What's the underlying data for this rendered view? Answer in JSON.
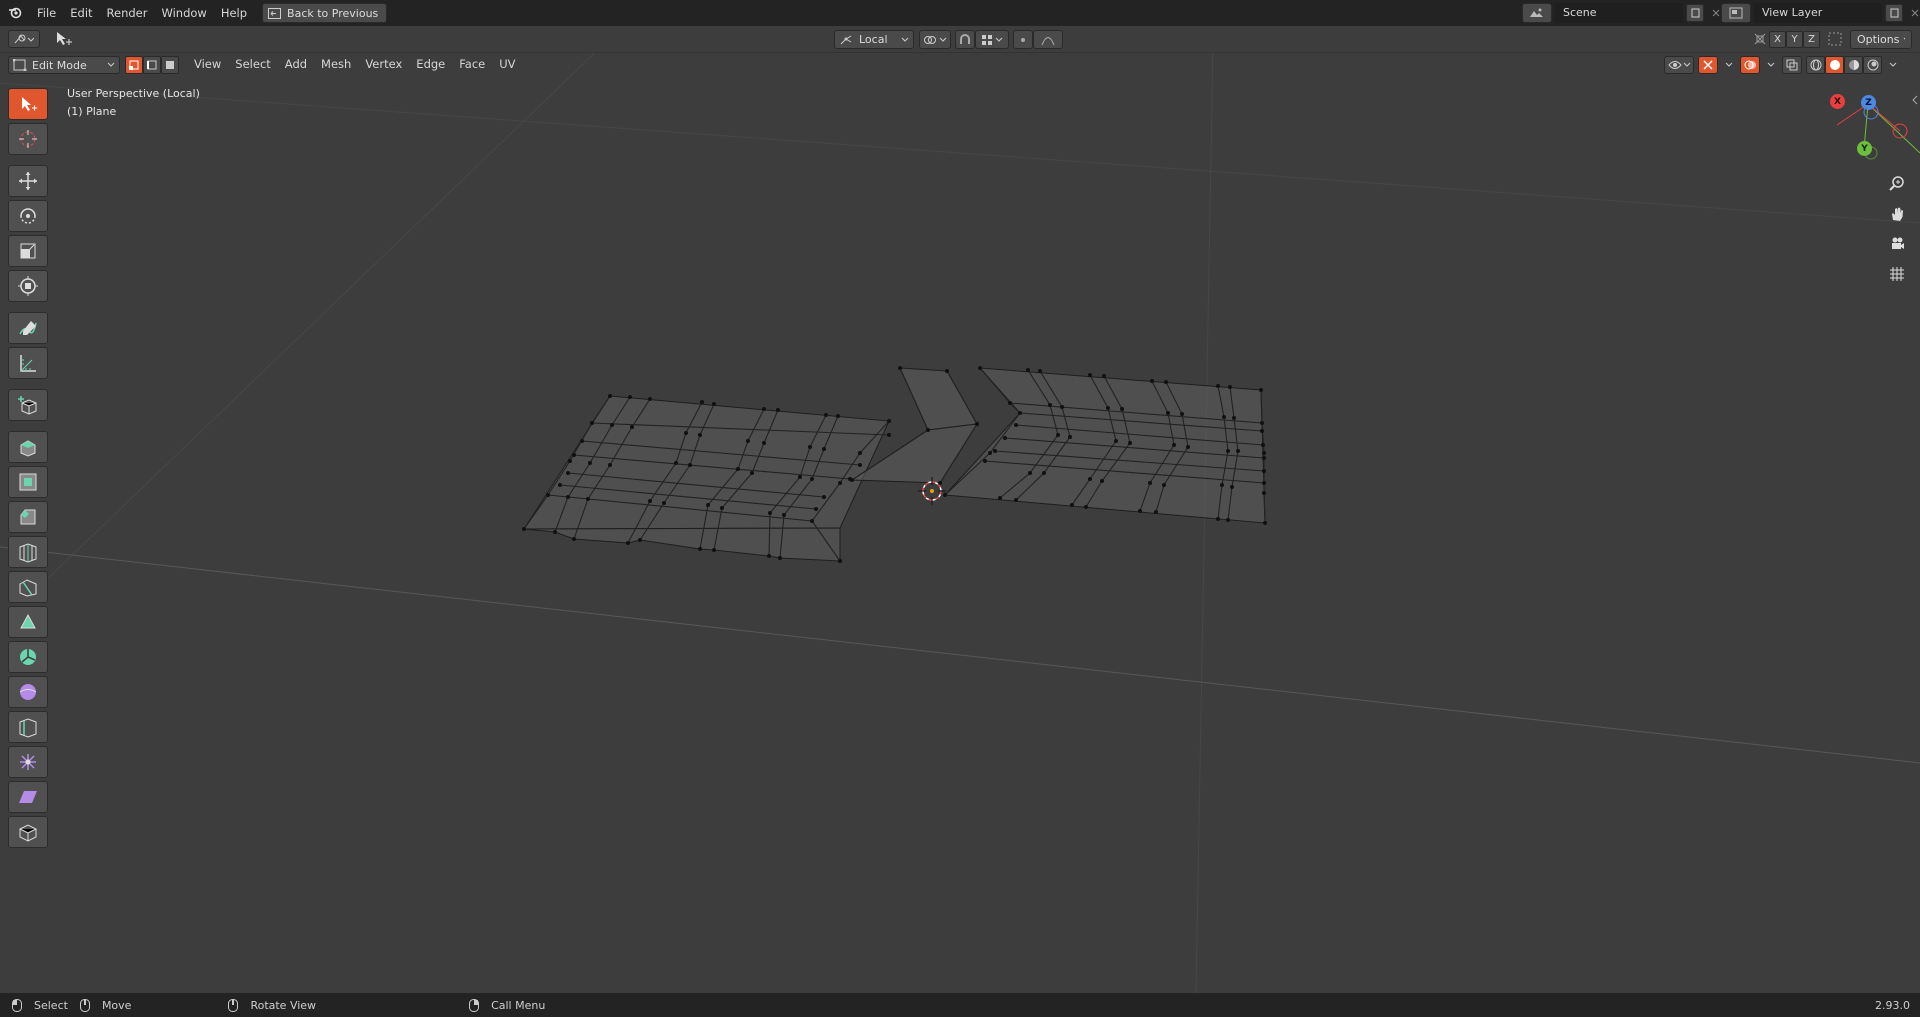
{
  "topbar": {
    "menus": [
      "File",
      "Edit",
      "Render",
      "Window",
      "Help"
    ],
    "back_button": "Back to Previous",
    "scene": "Scene",
    "view_layer": "View Layer"
  },
  "header": {
    "mode": "Edit Mode",
    "menus": [
      "View",
      "Select",
      "Add",
      "Mesh",
      "Vertex",
      "Edge",
      "Face",
      "UV"
    ],
    "transform_orientation": "Local",
    "options_label": "Options",
    "axis_labels": [
      "X",
      "Y",
      "Z"
    ]
  },
  "viewport": {
    "perspective_label": "User Perspective (Local)",
    "object_label": "(1) Plane",
    "gizmo_axes": [
      "X",
      "Y",
      "Z"
    ]
  },
  "toolbar": {
    "tools": [
      "select-box-icon",
      "cursor-icon",
      "move-icon",
      "rotate-icon",
      "scale-icon",
      "transform-icon",
      "annotate-icon",
      "measure-icon",
      "add-cube-icon",
      "extrude-icon",
      "inset-icon",
      "bevel-icon",
      "loop-cut-icon",
      "knife-icon",
      "poly-build-icon",
      "spin-icon",
      "smooth-icon",
      "edge-slide-icon",
      "shrink-fatten-icon",
      "shear-icon",
      "rip-icon"
    ]
  },
  "statusbar": {
    "select": "Select",
    "move": "Move",
    "rotate_view": "Rotate View",
    "call_menu": "Call Menu",
    "version": "2.93.0"
  },
  "colors": {
    "accent": "#e0562e",
    "background": "#3d3d3d",
    "topbar": "#232323",
    "axis_x": "#e64040",
    "axis_y": "#6cbf3c",
    "axis_z": "#4f88e0"
  }
}
